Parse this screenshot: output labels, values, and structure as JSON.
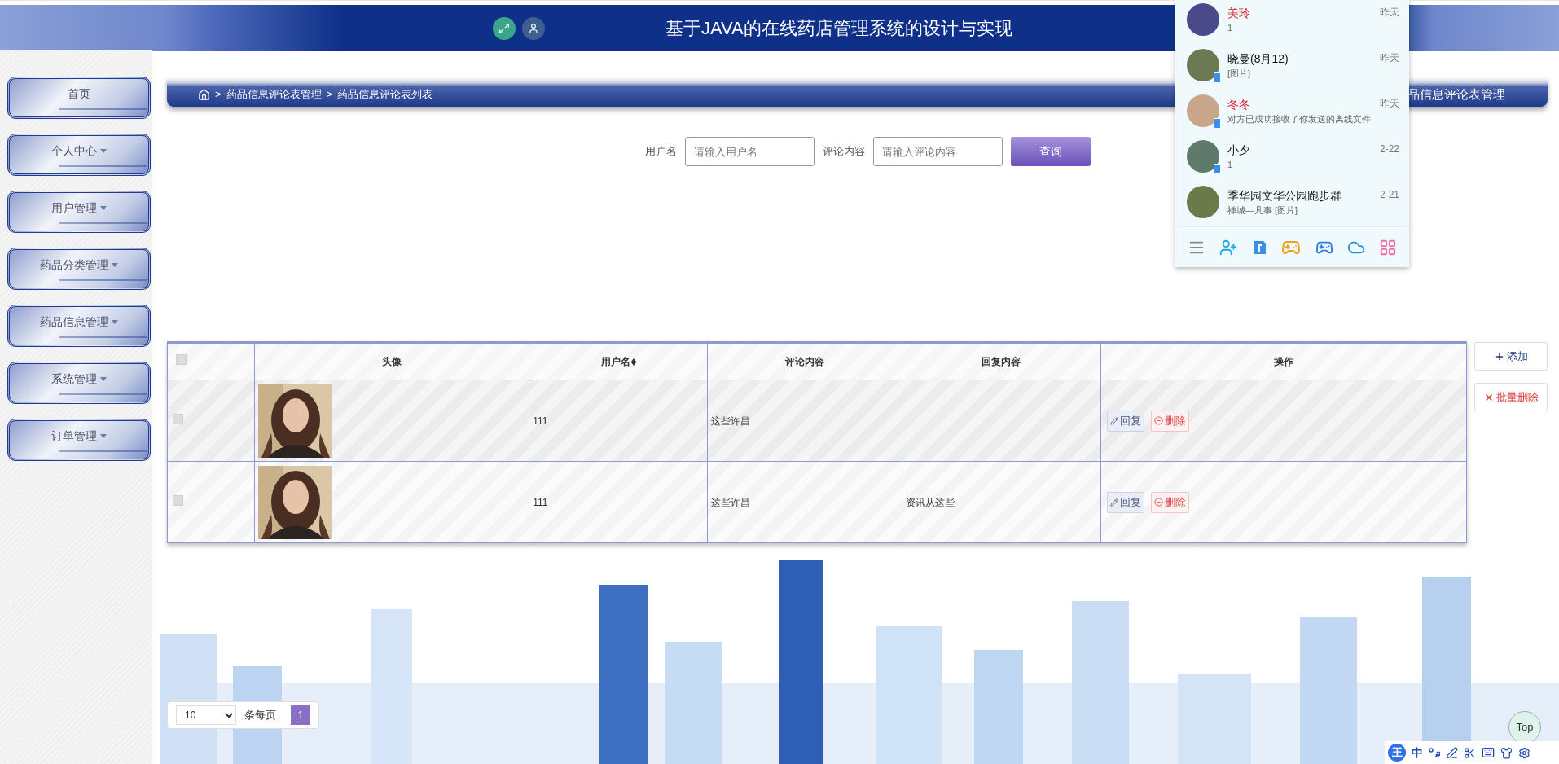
{
  "header": {
    "title": "基于JAVA的在线药店管理系统的设计与实现"
  },
  "sidebar": {
    "items": [
      {
        "label": "首页",
        "has_menu": false
      },
      {
        "label": "个人中心",
        "has_menu": true
      },
      {
        "label": "用户管理",
        "has_menu": true
      },
      {
        "label": "药品分类管理",
        "has_menu": true
      },
      {
        "label": "药品信息管理",
        "has_menu": true
      },
      {
        "label": "系统管理",
        "has_menu": true
      },
      {
        "label": "订单管理",
        "has_menu": true
      }
    ]
  },
  "breadcrumb": {
    "separator": ">",
    "items": [
      "药品信息评论表管理",
      "药品信息评论表列表"
    ],
    "page_title": "品信息评论表管理"
  },
  "search": {
    "fields": [
      {
        "label": "用户名",
        "placeholder": "请输入用户名"
      },
      {
        "label": "评论内容",
        "placeholder": "请输入评论内容"
      }
    ],
    "button": "查询"
  },
  "table": {
    "select_all_checked": false,
    "columns": [
      {
        "label": "头像",
        "sortable": false
      },
      {
        "label": "用户名",
        "sortable": true
      },
      {
        "label": "评论内容",
        "sortable": false
      },
      {
        "label": "回复内容",
        "sortable": false
      },
      {
        "label": "操作",
        "sortable": false
      }
    ],
    "rows": [
      {
        "checked": false,
        "username": "111",
        "comment": "这些许昌",
        "actions": [
          {
            "label": "回复",
            "kind": "reply"
          },
          {
            "label": "删除",
            "kind": "delete"
          }
        ]
      },
      {
        "checked": false,
        "username": "111",
        "comment": "这些许昌",
        "reply": "资讯从这些",
        "actions": [
          {
            "label": "回复",
            "kind": "reply"
          },
          {
            "label": "删除",
            "kind": "delete"
          }
        ]
      }
    ]
  },
  "side_actions": [
    {
      "label": "添加",
      "kind": "add"
    },
    {
      "label": "批量删除",
      "kind": "delete"
    }
  ],
  "pagination": {
    "page_size": "10",
    "page_size_suffix": "条每页",
    "pages": [
      {
        "label": "1",
        "selected": true
      }
    ]
  },
  "top_button": "Top",
  "ime_bar": {
    "logo": "王",
    "mode": "中"
  },
  "chat_popup": {
    "contacts": [
      {
        "name": "美玲",
        "message": "1",
        "time": "昨天",
        "highlight": true,
        "mobile": false,
        "color": "#4a4a8a"
      },
      {
        "name": "晓曼(8月12)",
        "message": "[图片]",
        "time": "昨天",
        "highlight": false,
        "mobile": true,
        "color": "#6b7a55"
      },
      {
        "name": "冬冬",
        "message": "对方已成功接收了你发送的离线文件",
        "time": "昨天",
        "highlight": true,
        "mobile": true,
        "color": "#c9a58a"
      },
      {
        "name": "小夕",
        "message": "1",
        "time": "2-22",
        "highlight": false,
        "mobile": true,
        "color": "#5d7a6a"
      },
      {
        "name": "季华园文华公园跑步群",
        "message": "禅城—凡事:[图片]",
        "time": "2-21",
        "highlight": false,
        "mobile": false,
        "color": "#6a7a4a"
      }
    ]
  }
}
